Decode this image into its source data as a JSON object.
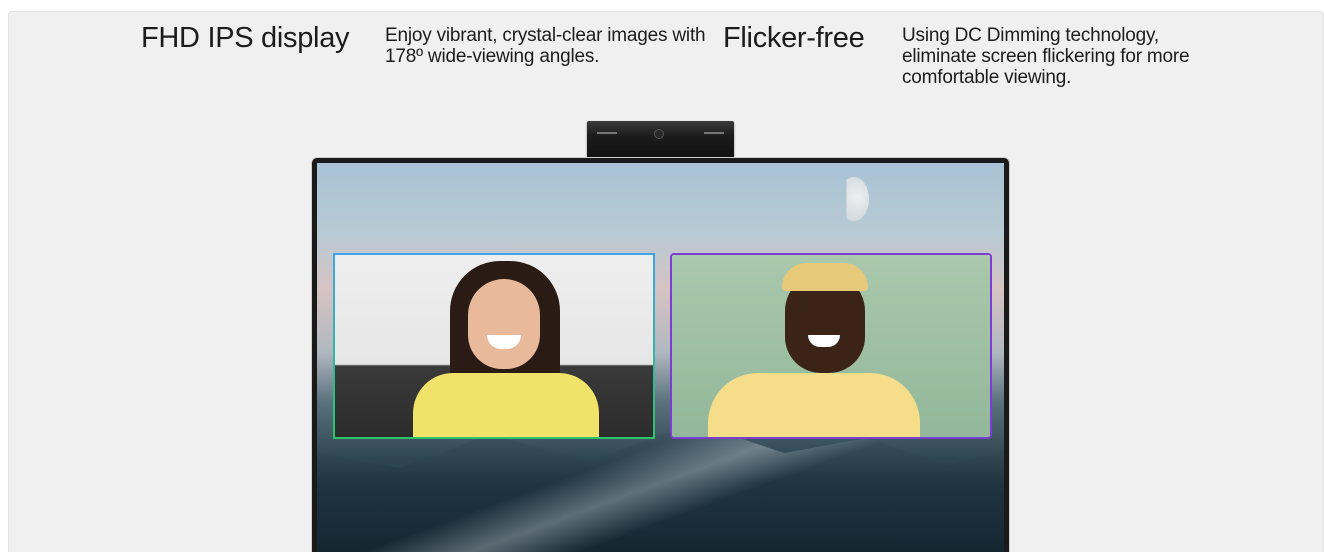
{
  "features": [
    {
      "title": "FHD IPS display",
      "description": "Enjoy vibrant, crystal-clear images with 178º wide-viewing angles."
    },
    {
      "title": "Flicker-free",
      "description": "Using DC Dimming technology, eliminate screen flickering for more comfortable viewing."
    }
  ],
  "colors": {
    "panel_background": "#f0f0f0",
    "text": "#1c1c1c",
    "tile1_border": "#3da4e8",
    "tile2_border": "#7a3fd1"
  }
}
